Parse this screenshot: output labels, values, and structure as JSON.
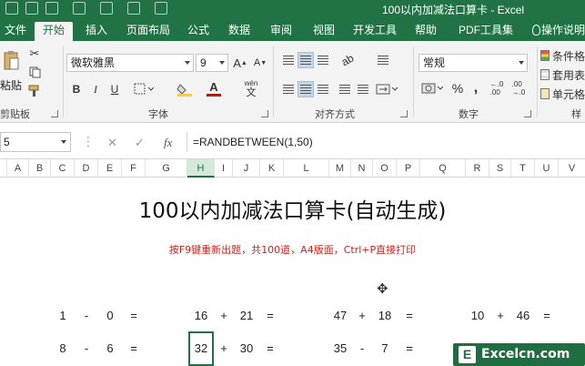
{
  "window": {
    "title": "100以内加减法口算卡 - Excel"
  },
  "tabs": [
    {
      "label": "文件"
    },
    {
      "label": "开始"
    },
    {
      "label": "插入"
    },
    {
      "label": "页面布局"
    },
    {
      "label": "公式"
    },
    {
      "label": "数据"
    },
    {
      "label": "审阅"
    },
    {
      "label": "视图"
    },
    {
      "label": "开发工具"
    },
    {
      "label": "帮助"
    },
    {
      "label": "PDF工具集"
    },
    {
      "label": "操作说明"
    }
  ],
  "ribbon": {
    "clipboard": {
      "paste_label": "粘贴",
      "group_label": "剪贴板"
    },
    "font": {
      "font_name": "微软雅黑",
      "font_size": "9",
      "grow": "A",
      "shrink": "A",
      "bold": "B",
      "italic": "I",
      "underline": "U",
      "font_color": "A",
      "wen": "wén",
      "wen_char": "文",
      "group_label": "字体"
    },
    "alignment": {
      "group_label": "对齐方式"
    },
    "number": {
      "format": "常规",
      "percent": "%",
      "comma": ",",
      "group_label": "数字"
    },
    "styles": {
      "items": [
        "条件格",
        "套用表",
        "单元格"
      ],
      "group_label": "样"
    }
  },
  "formula_bar": {
    "name_box": "5",
    "cancel": "✕",
    "confirm": "✓",
    "fx": "fx",
    "formula": "=RANDBETWEEN(1,50)"
  },
  "columns": [
    "A",
    "B",
    "C",
    "D",
    "E",
    "F",
    "G",
    "H",
    "I",
    "J",
    "K",
    "L",
    "M",
    "N",
    "O",
    "P",
    "Q",
    "R",
    "S",
    "T",
    "U",
    "V"
  ],
  "sheet": {
    "title": "100以内加减法口算卡(自动生成)",
    "subtitle": "按F9键重新出题，共100道，A4版面，Ctrl+P直接打印",
    "rows": [
      [
        "1",
        "-",
        "0",
        "=",
        "16",
        "+",
        "21",
        "=",
        "47",
        "+",
        "18",
        "=",
        "10",
        "+",
        "46",
        "="
      ],
      [
        "8",
        "-",
        "6",
        "=",
        "32",
        "+",
        "30",
        "=",
        "35",
        "-",
        "7",
        "=",
        "",
        "",
        "",
        ""
      ]
    ]
  },
  "watermark": {
    "logo": "E",
    "text": "Excelcn.com"
  },
  "colors": {
    "excel_green": "#217346",
    "subtitle_red": "#d0221c"
  }
}
